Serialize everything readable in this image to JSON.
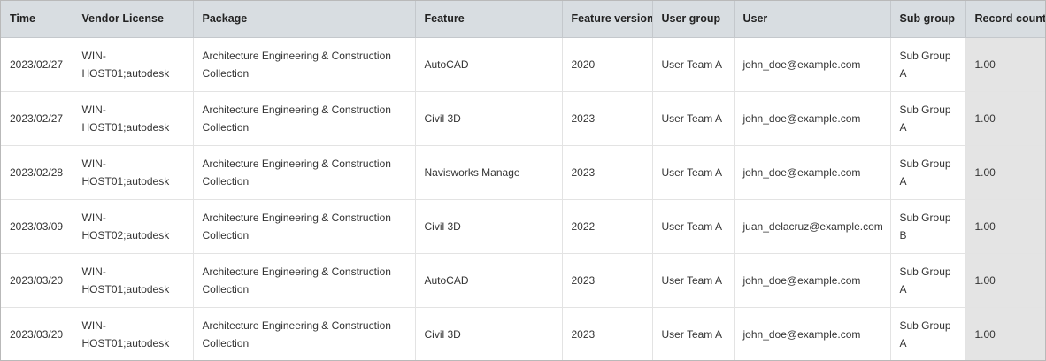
{
  "table": {
    "columns": [
      "Time",
      "Vendor License",
      "Package",
      "Feature",
      "Feature version",
      "User group",
      "User",
      "Sub group",
      "Record count"
    ],
    "rows": [
      {
        "time": "2023/02/27",
        "vendor_license": [
          "WIN-",
          "HOST01;autodesk"
        ],
        "package": [
          "Architecture Engineering & Construction",
          "Collection"
        ],
        "feature": "AutoCAD",
        "feature_version": "2020",
        "user_group": "User Team A",
        "user": "john_doe@example.com",
        "sub_group": [
          "Sub Group",
          "A"
        ],
        "record_count": "1.00"
      },
      {
        "time": "2023/02/27",
        "vendor_license": [
          "WIN-",
          "HOST01;autodesk"
        ],
        "package": [
          "Architecture Engineering & Construction",
          "Collection"
        ],
        "feature": "Civil 3D",
        "feature_version": "2023",
        "user_group": "User Team A",
        "user": "john_doe@example.com",
        "sub_group": [
          "Sub Group",
          "A"
        ],
        "record_count": "1.00"
      },
      {
        "time": "2023/02/28",
        "vendor_license": [
          "WIN-",
          "HOST01;autodesk"
        ],
        "package": [
          "Architecture Engineering & Construction",
          "Collection"
        ],
        "feature": "Navisworks Manage",
        "feature_version": "2023",
        "user_group": "User Team A",
        "user": "john_doe@example.com",
        "sub_group": [
          "Sub Group",
          "A"
        ],
        "record_count": "1.00"
      },
      {
        "time": "2023/03/09",
        "vendor_license": [
          "WIN-",
          "HOST02;autodesk"
        ],
        "package": [
          "Architecture Engineering & Construction",
          "Collection"
        ],
        "feature": "Civil 3D",
        "feature_version": "2022",
        "user_group": "User Team A",
        "user": "juan_delacruz@example.com",
        "sub_group": [
          "Sub Group",
          "B"
        ],
        "record_count": "1.00"
      },
      {
        "time": "2023/03/20",
        "vendor_license": [
          "WIN-",
          "HOST01;autodesk"
        ],
        "package": [
          "Architecture Engineering & Construction",
          "Collection"
        ],
        "feature": "AutoCAD",
        "feature_version": "2023",
        "user_group": "User Team A",
        "user": "john_doe@example.com",
        "sub_group": [
          "Sub Group",
          "A"
        ],
        "record_count": "1.00"
      },
      {
        "time": "2023/03/20",
        "vendor_license": [
          "WIN-",
          "HOST01;autodesk"
        ],
        "package": [
          "Architecture Engineering & Construction",
          "Collection"
        ],
        "feature": "Civil 3D",
        "feature_version": "2023",
        "user_group": "User Team A",
        "user": "john_doe@example.com",
        "sub_group": [
          "Sub Group",
          "A"
        ],
        "record_count": "1.00"
      }
    ]
  }
}
